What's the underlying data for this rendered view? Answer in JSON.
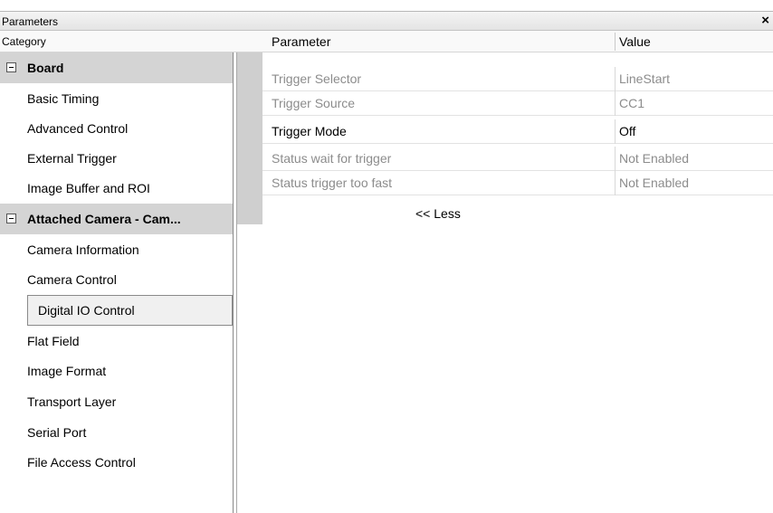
{
  "window": {
    "title": "Parameters"
  },
  "columns": {
    "category": "Category",
    "parameter": "Parameter",
    "value": "Value"
  },
  "categories": [
    {
      "label": "Board",
      "group": true
    },
    {
      "label": "Basic Timing"
    },
    {
      "label": "Advanced Control"
    },
    {
      "label": "External Trigger"
    },
    {
      "label": "Image Buffer and ROI"
    },
    {
      "label": "Attached Camera - Cam...",
      "group": true
    },
    {
      "label": "Camera Information"
    },
    {
      "label": "Camera Control"
    },
    {
      "label": "Digital IO Control",
      "selected": true
    },
    {
      "label": "Flat Field"
    },
    {
      "label": "Image Format"
    },
    {
      "label": "Transport Layer"
    },
    {
      "label": "Serial Port"
    },
    {
      "label": "File Access Control"
    }
  ],
  "parameters": [
    {
      "name": "Trigger Selector",
      "value": "LineStart",
      "readonly": true
    },
    {
      "name": "Trigger Source",
      "value": "CC1",
      "readonly": true
    },
    {
      "name": "Trigger Mode",
      "value": "Off",
      "readonly": false
    },
    {
      "name": "Status wait for trigger",
      "value": "Not Enabled",
      "readonly": true
    },
    {
      "name": "Status trigger too fast",
      "value": "Not Enabled",
      "readonly": true
    }
  ],
  "less_link": "<< Less"
}
